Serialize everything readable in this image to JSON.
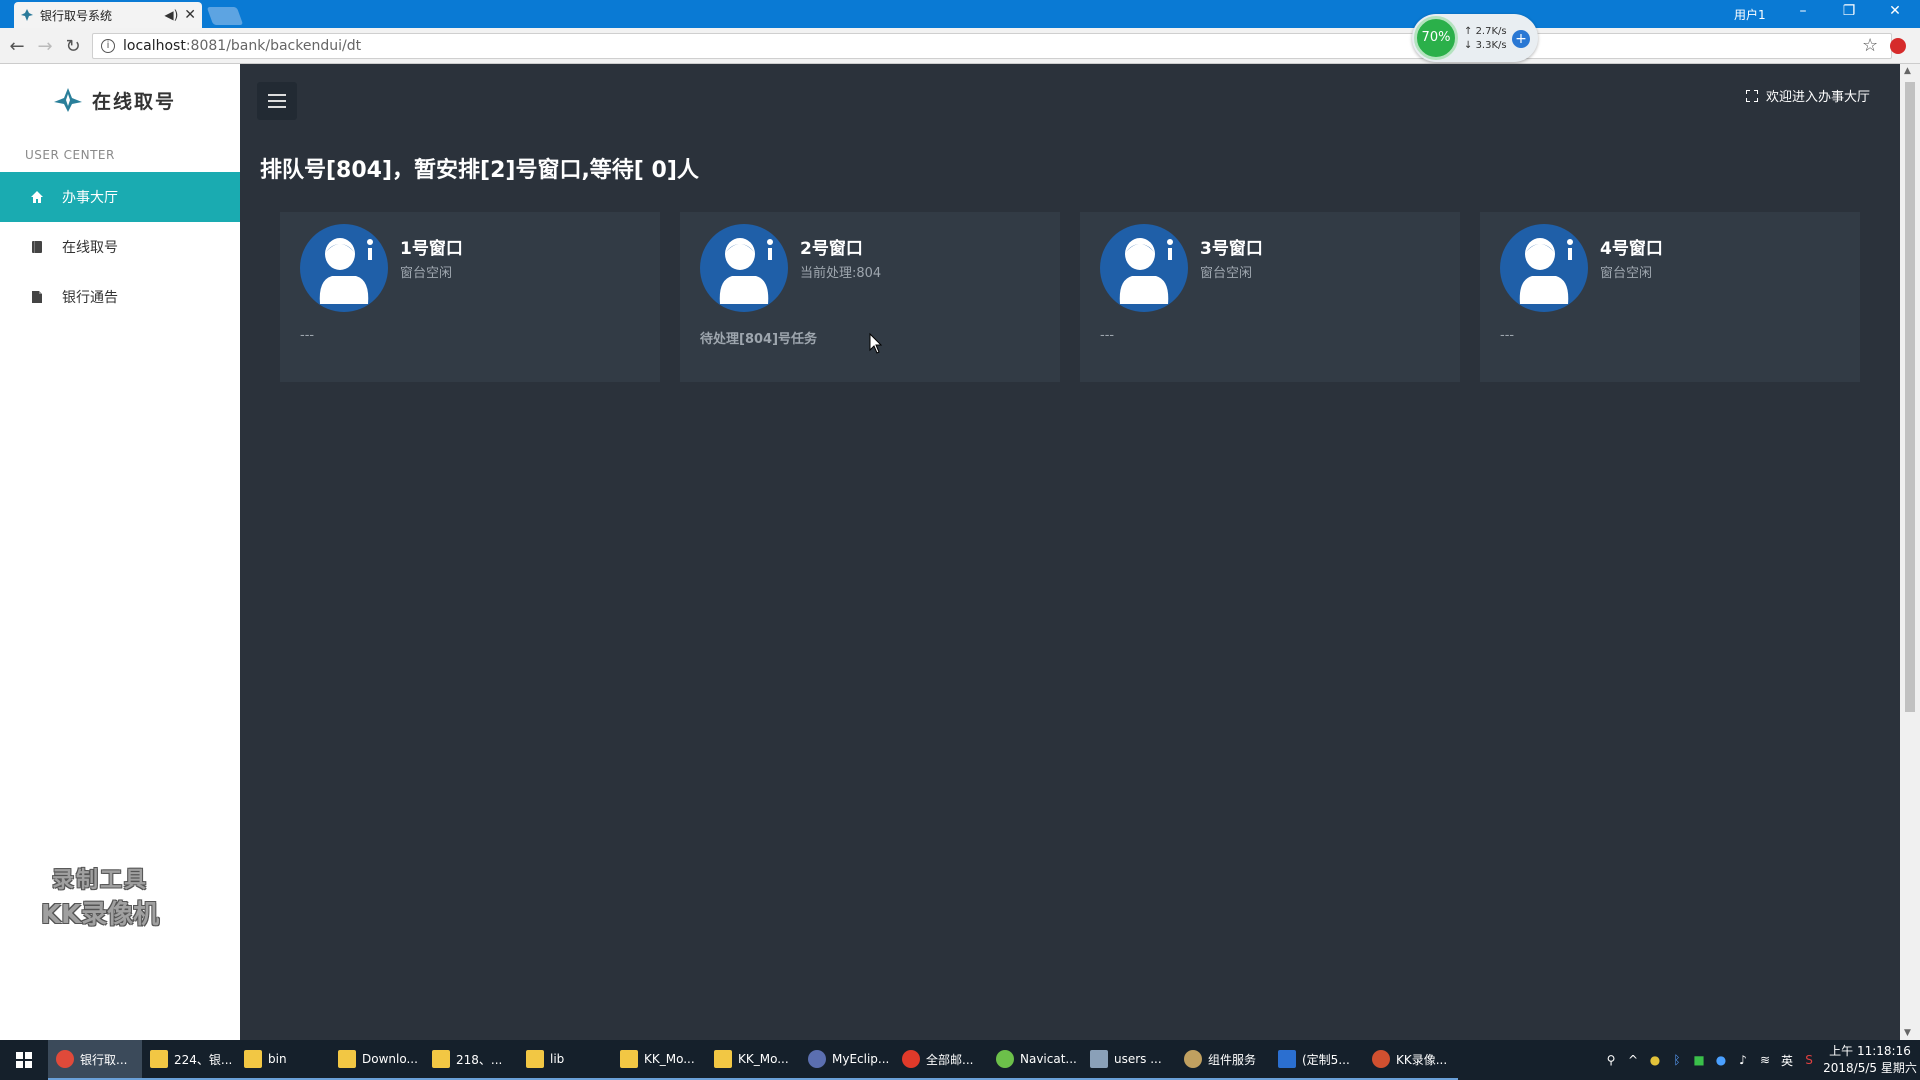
{
  "browser": {
    "tab_title": "银行取号系统",
    "user_label": "用户1",
    "url_host": "localhost",
    "url_rest": ":8081/bank/backendui/dt",
    "net_widget": {
      "percent": "70%",
      "up": "2.7K/s",
      "down": "3.3K/s"
    }
  },
  "sidebar": {
    "logo_text": "在线取号",
    "section_label": "USER CENTER",
    "items": [
      {
        "label": "办事大厅",
        "icon": "home-icon",
        "active": true
      },
      {
        "label": "在线取号",
        "icon": "book-icon",
        "active": false
      },
      {
        "label": "银行通告",
        "icon": "file-icon",
        "active": false
      }
    ],
    "watermark": {
      "line1": "录制工具",
      "line2": "KK录像机"
    }
  },
  "header": {
    "welcome": "欢迎进入办事大厅"
  },
  "queue_status": "排队号[804]，暂安排[2]号窗口,等待[ 0]人",
  "windows": [
    {
      "name": "1号窗口",
      "status": "窗台空闲",
      "task": "---"
    },
    {
      "name": "2号窗口",
      "status": "当前处理:804",
      "task": "待处理[804]号任务"
    },
    {
      "name": "3号窗口",
      "status": "窗台空闲",
      "task": "---"
    },
    {
      "name": "4号窗口",
      "status": "窗台空闲",
      "task": "---"
    }
  ],
  "colors": {
    "accent": "#1aabb1",
    "main_bg": "#2b323b",
    "card_bg": "#323b45",
    "avatar_blue": "#1f5fa8"
  },
  "taskbar": {
    "items": [
      {
        "label": "银行取...",
        "icon": "chrome-icon"
      },
      {
        "label": "224、银...",
        "icon": "folder-icon"
      },
      {
        "label": "bin",
        "icon": "folder-icon"
      },
      {
        "label": "Downlo...",
        "icon": "folder-icon"
      },
      {
        "label": "218、...",
        "icon": "folder-icon"
      },
      {
        "label": "lib",
        "icon": "folder-icon"
      },
      {
        "label": "KK_Mo...",
        "icon": "folder-icon"
      },
      {
        "label": "KK_Mo...",
        "icon": "folder-icon"
      },
      {
        "label": "MyEclip...",
        "icon": "eclipse-icon"
      },
      {
        "label": "全部邮...",
        "icon": "mail-icon"
      },
      {
        "label": "Navicat...",
        "icon": "navicat-icon"
      },
      {
        "label": "users ...",
        "icon": "users-icon"
      },
      {
        "label": "组件服务",
        "icon": "component-icon"
      },
      {
        "label": "(定制5...",
        "icon": "word-icon"
      },
      {
        "label": "KK录像...",
        "icon": "kk-icon"
      }
    ],
    "ime": "英",
    "time": "上午 11:18:16",
    "date": "2018/5/5 星期六"
  }
}
